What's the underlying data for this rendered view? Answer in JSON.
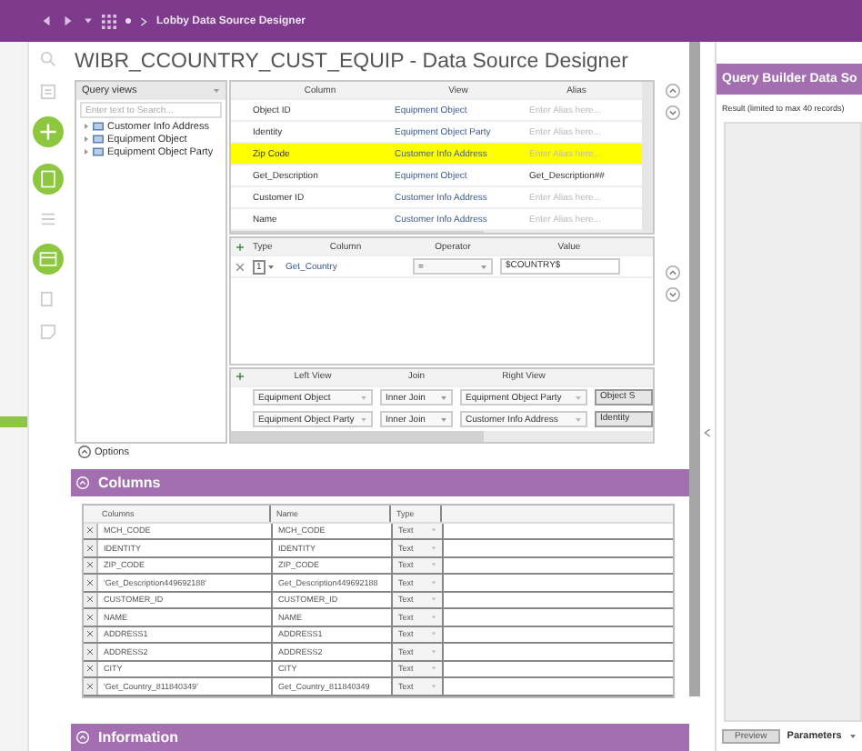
{
  "breadcrumb": {
    "path": "Lobby Data Source Designer"
  },
  "title": "WIBR_CCOUNTRY_CUST_EQUIP - Data Source Designer",
  "query_views": {
    "header": "Query views",
    "search": {
      "placeholder": "Enter text to Search..."
    },
    "items": [
      {
        "label": "Customer Info Address"
      },
      {
        "label": "Equipment Object"
      },
      {
        "label": "Equipment Object Party"
      }
    ]
  },
  "view_columns": {
    "columns": [
      "Column",
      "View",
      "Alias"
    ],
    "rows": [
      {
        "column": "Object ID",
        "view": "Equipment Object",
        "alias_placeholder": "Enter Alias here...",
        "selected": false
      },
      {
        "column": "Identity",
        "view": "Equipment Object Party",
        "alias_placeholder": "Enter Alias here...",
        "selected": false
      },
      {
        "column": "Zip Code",
        "view": "Customer Info Address",
        "alias_placeholder": "Enter Alias here...",
        "selected": true
      },
      {
        "column": "Get_Description",
        "view": "Equipment Object",
        "alias": "Get_Description##",
        "selected": false
      },
      {
        "column": "Customer ID",
        "view": "Customer Info Address",
        "alias_placeholder": "Enter Alias here...",
        "selected": false
      },
      {
        "column": "Name",
        "view": "Customer Info Address",
        "alias_placeholder": "Enter Alias here...",
        "selected": false
      }
    ]
  },
  "filters": {
    "columns": [
      "Type",
      "Column",
      "Operator",
      "Value"
    ],
    "rows": [
      {
        "type": "1",
        "column": "Get_Country",
        "operator": "=",
        "value": "$COUNTRY$"
      }
    ]
  },
  "joins": {
    "columns": [
      "Left View",
      "Join",
      "Right View"
    ],
    "rows": [
      {
        "left": "Equipment Object",
        "join": "Inner Join",
        "right": "Equipment Object Party",
        "column_4": "Object S"
      },
      {
        "left": "Equipment Object Party",
        "join": "Inner Join",
        "right": "Customer Info Address",
        "column_4": "Identity"
      }
    ]
  },
  "options": {
    "label": "Options"
  },
  "columns_section": {
    "title": "Columns",
    "headers": [
      "Columns",
      "Name",
      "Type"
    ],
    "rows": [
      {
        "column": "MCH_CODE",
        "name": "MCH_CODE",
        "type": "Text"
      },
      {
        "column": "IDENTITY",
        "name": "IDENTITY",
        "type": "Text"
      },
      {
        "column": "ZIP_CODE",
        "name": "ZIP_CODE",
        "type": "Text"
      },
      {
        "column": "'Get_Description449692188'",
        "name": "Get_Description449692188",
        "type": "Text"
      },
      {
        "column": "CUSTOMER_ID",
        "name": "CUSTOMER_ID",
        "type": "Text"
      },
      {
        "column": "NAME",
        "name": "NAME",
        "type": "Text"
      },
      {
        "column": "ADDRESS1",
        "name": "ADDRESS1",
        "type": "Text"
      },
      {
        "column": "ADDRESS2",
        "name": "ADDRESS2",
        "type": "Text"
      },
      {
        "column": "CITY",
        "name": "CITY",
        "type": "Text"
      },
      {
        "column": "'Get_Country_811840349'",
        "name": "Get_Country_811840349",
        "type": "Text"
      }
    ]
  },
  "information_section": {
    "title": "Information"
  },
  "result_panel": {
    "title": "Query Builder Data So",
    "caption": "Result (limited to max 40 records)",
    "preview_button": "Preview",
    "parameters_tab": "Parameters"
  }
}
